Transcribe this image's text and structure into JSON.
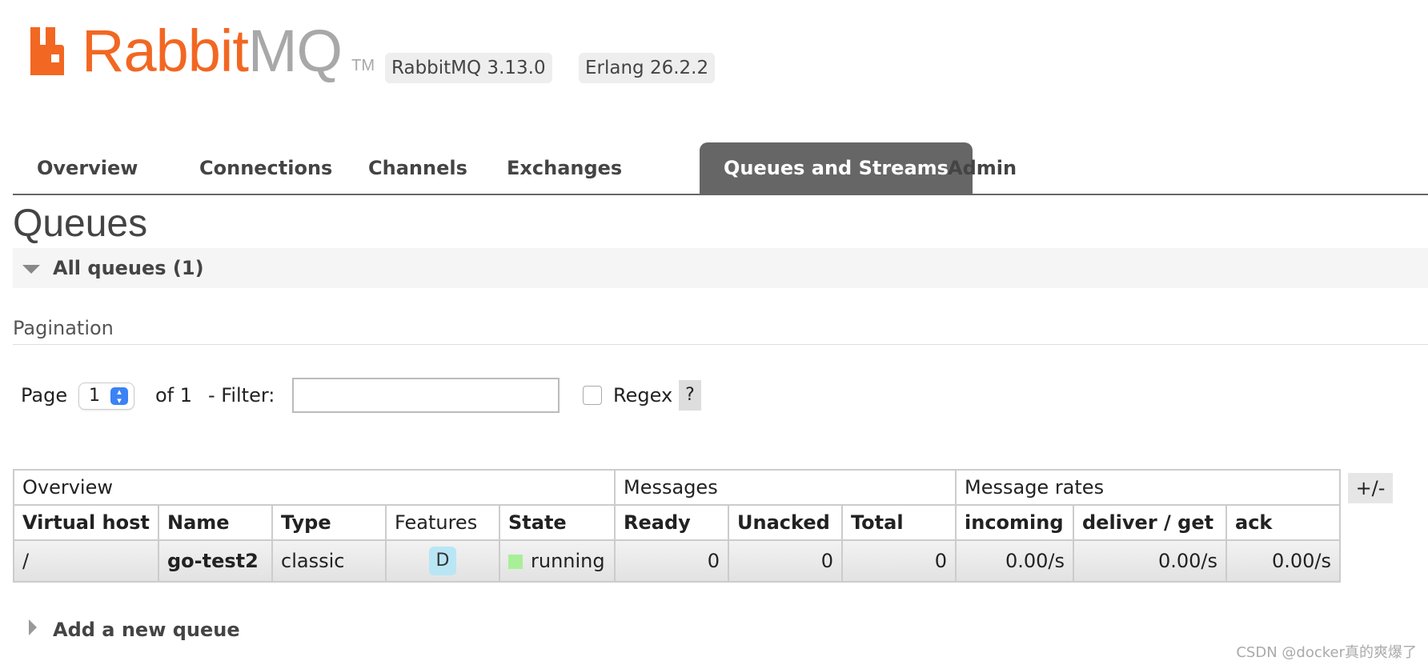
{
  "header": {
    "logo_rabbit": "Rabbit",
    "logo_mq": "MQ",
    "logo_tm": "TM",
    "version_badge": "RabbitMQ 3.13.0",
    "erlang_badge": "Erlang 26.2.2",
    "brand_color": "#f26722"
  },
  "tabs": [
    {
      "label": "Overview"
    },
    {
      "label": "Connections"
    },
    {
      "label": "Channels"
    },
    {
      "label": "Exchanges"
    },
    {
      "label": "Queues and Streams",
      "active": true
    },
    {
      "label": "Admin"
    }
  ],
  "page_title": "Queues",
  "section": {
    "label": "All queues (1)"
  },
  "pagination": {
    "heading": "Pagination",
    "page_label": "Page",
    "page_value": "1",
    "of_label": "of 1",
    "filter_label": "- Filter:",
    "filter_value": "",
    "regex_label": "Regex",
    "regex_checked": false,
    "help_label": "?"
  },
  "table": {
    "groups": [
      "Overview",
      "Messages",
      "Message rates"
    ],
    "plus_minus": "+/-",
    "columns": [
      "Virtual host",
      "Name",
      "Type",
      "Features",
      "State",
      "Ready",
      "Unacked",
      "Total",
      "incoming",
      "deliver / get",
      "ack"
    ],
    "rows": [
      {
        "virtual_host": "/",
        "name": "go-test2",
        "type": "classic",
        "features": "D",
        "state": "running",
        "ready": "0",
        "unacked": "0",
        "total": "0",
        "incoming": "0.00/s",
        "deliver_get": "0.00/s",
        "ack": "0.00/s"
      }
    ],
    "state_color": "#a8ef98"
  },
  "add_queue": {
    "label": "Add a new queue"
  },
  "watermark": "CSDN @docker真的爽爆了"
}
